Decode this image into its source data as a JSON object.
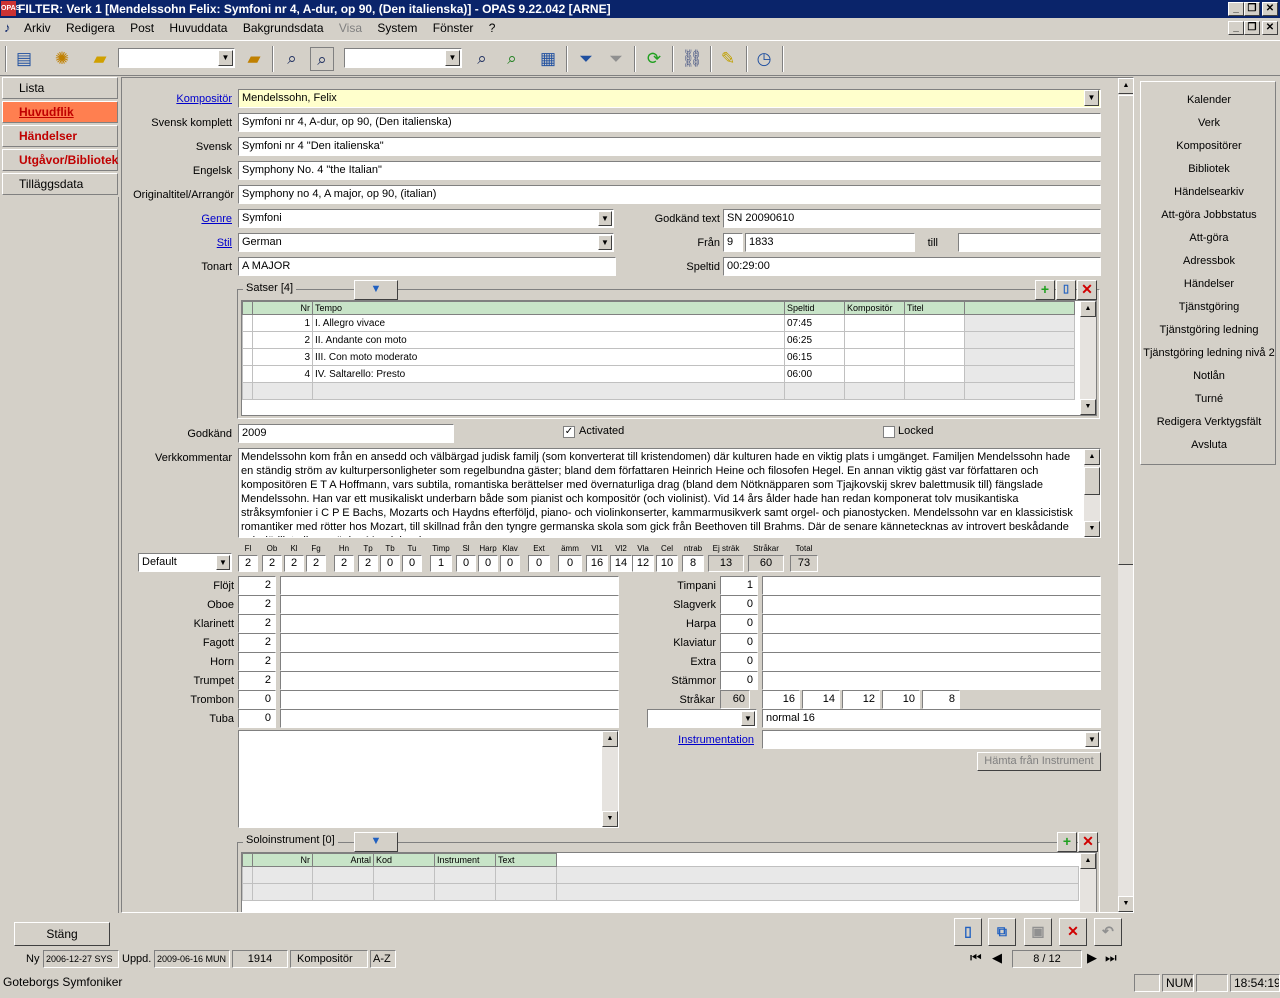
{
  "window": {
    "icon_text": "OPAS",
    "title": "FILTER: Verk  1 [Mendelssohn Felix: Symfoni nr 4, A-dur, op 90, (Den italienska)] - OPAS 9.22.042  [ARNE]"
  },
  "menu": [
    "Arkiv",
    "Redigera",
    "Post",
    "Huvuddata",
    "Bakgrundsdata",
    "Visa",
    "System",
    "Fönster",
    "?"
  ],
  "toolbar": {
    "combo1": "",
    "combo2": ""
  },
  "nav": {
    "lista": "Lista",
    "huvudflik": "Huvudflik",
    "handelser": "Händelser",
    "utgavor": "Utgåvor/Bibliotek",
    "tillagg": "Tilläggsdata"
  },
  "form": {
    "kompositor_label": "Kompositör",
    "kompositor": "Mendelssohn, Felix",
    "svensk_komplett_label": "Svensk komplett",
    "svensk_komplett": "Symfoni nr 4, A-dur, op 90, (Den italienska)",
    "svensk_label": "Svensk",
    "svensk": "Symfoni nr 4  \"Den italienska\"",
    "engelsk_label": "Engelsk",
    "engelsk": "Symphony No. 4 \"the Italian\"",
    "original_label": "Originaltitel/Arrangör",
    "original": "Symphony no 4, A major, op 90, (italian)",
    "genre_label": "Genre",
    "genre": "Symfoni",
    "stil_label": "Stil",
    "stil": "German",
    "tonart_label": "Tonart",
    "tonart": "A MAJOR",
    "godkand_text_label": "Godkänd text",
    "godkand_text": "SN 20090610",
    "fran_label": "Från",
    "fran_prefix": "9",
    "fran": "1833",
    "till_label": "till",
    "till": "",
    "speltid_label": "Speltid",
    "speltid": "00:29:00",
    "godkand_label": "Godkänd",
    "godkand": "2009",
    "activated_label": "Activated",
    "locked_label": "Locked",
    "verkkommentar_label": "Verkkommentar",
    "verkkommentar": "Mendelssohn kom från en ansedd och välbärgad judisk familj (som konverterat till kristendomen) där kulturen hade en viktig plats i umgänget. Familjen Mendelssohn hade en ständig ström av kulturpersonligheter som regelbundna gäster; bland dem författaren Heinrich Heine och filosofen Hegel. En annan viktig gäst var författaren och kompositören E T A Hoffmann, vars subtila, romantiska berättelser med övernaturliga drag (bland dem Nötknäpparen som Tjajkovskij skrev balettmusik till) fängslade Mendelssohn. Han var ett musikaliskt underbarn både som pianist och kompositör (och violinist). Vid 14 års ålder hade han redan komponerat tolv musikantiska stråksymfonier i C P E Bachs, Mozarts och Haydns efterföljd, piano- och violinkonserter, kammarmusikverk samt orgel- och pianostycken.  Mendelssohn var en klassicistisk romantiker med rötter hos Mozart, till skillnad från den tyngre germanska skola som gick från Beethoven till Brahms. Där de senare kännetecknas av introvert beskådande och dödligt allvar präglas Mendelssohns"
  },
  "satser": {
    "title": "Satser  [4]",
    "headers": [
      "Nr",
      "Tempo",
      "Speltid",
      "Kompositör",
      "Titel"
    ],
    "rows": [
      {
        "nr": "1",
        "tempo": "I. Allegro vivace",
        "speltid": "07:45"
      },
      {
        "nr": "2",
        "tempo": "II. Andante con moto",
        "speltid": "06:25"
      },
      {
        "nr": "3",
        "tempo": "III. Con moto moderato",
        "speltid": "06:15"
      },
      {
        "nr": "4",
        "tempo": "IV. Saltarello: Presto",
        "speltid": "06:00"
      }
    ]
  },
  "orchestration": {
    "preset": "Default",
    "headers": [
      "Fl",
      "Ob",
      "Kl",
      "Fg",
      "Hn",
      "Tp",
      "Tb",
      "Tu",
      "Timp",
      "Sl",
      "Harp",
      "Klav",
      "Ext",
      "ämm",
      "Vl1",
      "Vl2",
      "Vla",
      "Cel",
      "ntrab",
      "Ej sträk",
      "Stråkar",
      "Total"
    ],
    "values": [
      "2",
      "2",
      "2",
      "2",
      "2",
      "2",
      "0",
      "0",
      "1",
      "0",
      "0",
      "0",
      "0",
      "0",
      "16",
      "14",
      "12",
      "10",
      "8",
      "13",
      "60",
      "73"
    ],
    "left": [
      {
        "label": "Flöjt",
        "value": "2",
        "text": ""
      },
      {
        "label": "Oboe",
        "value": "2",
        "text": ""
      },
      {
        "label": "Klarinett",
        "value": "2",
        "text": ""
      },
      {
        "label": "Fagott",
        "value": "2",
        "text": ""
      },
      {
        "label": "Horn",
        "value": "2",
        "text": ""
      },
      {
        "label": "Trumpet",
        "value": "2",
        "text": ""
      },
      {
        "label": "Trombon",
        "value": "0",
        "text": ""
      },
      {
        "label": "Tuba",
        "value": "0",
        "text": ""
      }
    ],
    "right": [
      {
        "label": "Timpani",
        "value": "1",
        "text": ""
      },
      {
        "label": "Slagverk",
        "value": "0",
        "text": ""
      },
      {
        "label": "Harpa",
        "value": "0",
        "text": ""
      },
      {
        "label": "Klaviatur",
        "value": "0",
        "text": ""
      },
      {
        "label": "Extra",
        "value": "0",
        "text": ""
      },
      {
        "label": "Stämmor",
        "value": "0",
        "text": ""
      }
    ],
    "strakar_label": "Stråkar",
    "strakar_total": "60",
    "strakar_values": [
      "16",
      "14",
      "12",
      "10",
      "8"
    ],
    "string_preset": "",
    "string_desc": "normal 16",
    "instrumentation_label": "Instrumentation",
    "instrumentation": "",
    "hamta_button": "Hämta från Instrument"
  },
  "solo": {
    "title": "Soloinstrument  [0]",
    "headers": [
      "Nr",
      "Antal",
      "Kod",
      "Instrument",
      "Text"
    ]
  },
  "right_menu": [
    "Kalender",
    "Verk",
    "Kompositörer",
    "Bibliotek",
    "Händelsearkiv",
    "Att-göra Jobbstatus",
    "Att-göra",
    "Adressbok",
    "Händelser",
    "Tjänstgöring",
    "Tjänstgöring ledning",
    "Tjänstgöring ledning nivå 2",
    "Notlån",
    "Turné",
    "Redigera Verktygsfält",
    "Avsluta"
  ],
  "bottom": {
    "stang": "Stäng",
    "ny_label": "Ny",
    "ny": "2006-12-27 SYS",
    "uppd_label": "Uppd.",
    "uppd": "2009-06-16 MUN",
    "id": "1914",
    "sort_field": "Kompositör",
    "sort_order": "A-Z",
    "record": "8 / 12"
  },
  "statusbar": {
    "org": "Goteborgs Symfoniker",
    "num": "NUM",
    "time": "18:54:19"
  }
}
